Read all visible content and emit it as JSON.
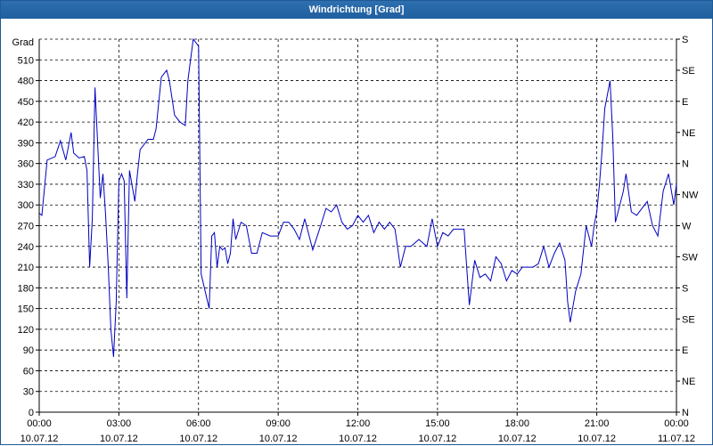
{
  "window": {
    "title": "Windrichtung [Grad]"
  },
  "chart_data": {
    "type": "line",
    "title": "Windrichtung [Grad]",
    "ylabel": "Grad",
    "ylim": [
      0,
      540
    ],
    "xlim": [
      0,
      24
    ],
    "grid": true,
    "y_ticks": [
      0,
      30,
      60,
      90,
      120,
      150,
      180,
      210,
      240,
      270,
      300,
      330,
      360,
      390,
      420,
      450,
      480,
      510
    ],
    "right_axis_labels": [
      "N",
      "NE",
      "E",
      "SE",
      "S",
      "SW",
      "W",
      "NW",
      "N",
      "NE",
      "E",
      "SE",
      "S"
    ],
    "x_ticks": [
      {
        "time": "00:00",
        "date": "10.07.12"
      },
      {
        "time": "03:00",
        "date": "10.07.12"
      },
      {
        "time": "06:00",
        "date": "10.07.12"
      },
      {
        "time": "09:00",
        "date": "10.07.12"
      },
      {
        "time": "12:00",
        "date": "10.07.12"
      },
      {
        "time": "15:00",
        "date": "10.07.12"
      },
      {
        "time": "18:00",
        "date": "10.07.12"
      },
      {
        "time": "21:00",
        "date": "10.07.12"
      },
      {
        "time": "00:00",
        "date": "11.07.12"
      }
    ],
    "series": [
      {
        "color": "#0000c0",
        "x": [
          0,
          0.1,
          0.3,
          0.6,
          0.8,
          1.0,
          1.2,
          1.3,
          1.5,
          1.7,
          1.8,
          1.9,
          2.0,
          2.1,
          2.3,
          2.4,
          2.5,
          2.6,
          2.7,
          2.8,
          2.9,
          3.0,
          3.1,
          3.2,
          3.3,
          3.4,
          3.6,
          3.7,
          3.8,
          4.1,
          4.3,
          4.4,
          4.6,
          4.8,
          4.9,
          5.1,
          5.3,
          5.5,
          5.6,
          5.8,
          6.0,
          6.1,
          6.4,
          6.5,
          6.6,
          6.7,
          6.8,
          6.9,
          7.0,
          7.1,
          7.2,
          7.3,
          7.4,
          7.6,
          7.8,
          8.0,
          8.2,
          8.4,
          8.7,
          9.0,
          9.2,
          9.4,
          9.6,
          9.8,
          10.0,
          10.3,
          10.6,
          10.8,
          11.0,
          11.2,
          11.4,
          11.6,
          11.8,
          12.0,
          12.2,
          12.4,
          12.6,
          12.8,
          13.0,
          13.2,
          13.4,
          13.6,
          13.8,
          14.0,
          14.3,
          14.6,
          14.8,
          15.0,
          15.2,
          15.4,
          15.6,
          15.8,
          16.0,
          16.2,
          16.4,
          16.6,
          16.8,
          17.0,
          17.2,
          17.4,
          17.6,
          17.8,
          18.0,
          18.2,
          18.4,
          18.6,
          18.8,
          19.0,
          19.2,
          19.4,
          19.6,
          19.8,
          19.9,
          20.0,
          20.2,
          20.4,
          20.6,
          20.8,
          20.9,
          21.0,
          21.1,
          21.2,
          21.3,
          21.5,
          21.6,
          21.7,
          21.8,
          22.0,
          22.1,
          22.3,
          22.5,
          22.7,
          22.9,
          23.1,
          23.3,
          23.5,
          23.7,
          23.9,
          24.0
        ],
        "y": [
          288,
          285,
          365,
          370,
          393,
          365,
          405,
          375,
          368,
          370,
          350,
          210,
          280,
          470,
          310,
          345,
          285,
          210,
          120,
          80,
          160,
          335,
          345,
          335,
          165,
          350,
          305,
          345,
          380,
          395,
          395,
          410,
          485,
          495,
          480,
          430,
          420,
          415,
          480,
          540,
          530,
          200,
          150,
          255,
          260,
          210,
          240,
          235,
          238,
          215,
          230,
          280,
          250,
          275,
          270,
          230,
          230,
          260,
          255,
          255,
          275,
          275,
          265,
          250,
          280,
          235,
          270,
          295,
          290,
          300,
          275,
          265,
          270,
          285,
          275,
          285,
          260,
          275,
          265,
          275,
          265,
          210,
          240,
          240,
          250,
          240,
          280,
          240,
          260,
          255,
          265,
          265,
          265,
          155,
          220,
          195,
          200,
          190,
          225,
          215,
          190,
          205,
          200,
          210,
          210,
          210,
          215,
          240,
          210,
          230,
          245,
          220,
          160,
          130,
          175,
          200,
          270,
          240,
          270,
          290,
          330,
          380,
          440,
          480,
          400,
          275,
          290,
          320,
          345,
          290,
          285,
          295,
          305,
          270,
          255,
          320,
          345,
          300,
          330
        ]
      }
    ]
  }
}
